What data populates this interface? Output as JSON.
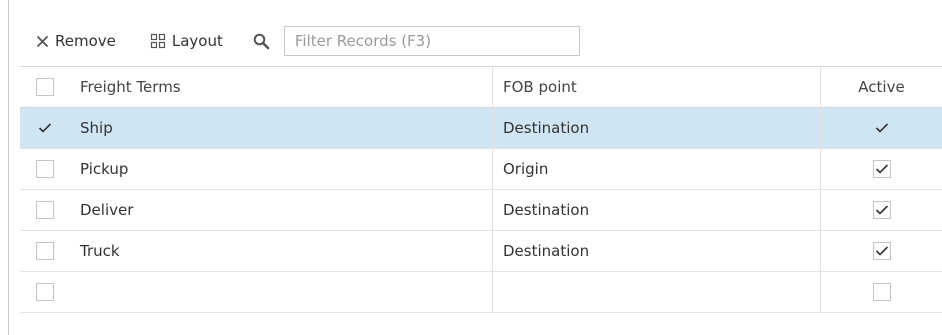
{
  "toolbar": {
    "remove_label": "Remove",
    "layout_label": "Layout",
    "filter_placeholder": "Filter Records (F3)"
  },
  "grid": {
    "columns": [
      "Freight Terms",
      "FOB point",
      "Active"
    ],
    "rows": [
      {
        "freight_terms": "Ship",
        "fob_point": "Destination",
        "active": true,
        "selected": true
      },
      {
        "freight_terms": "Pickup",
        "fob_point": "Origin",
        "active": true,
        "selected": false
      },
      {
        "freight_terms": "Deliver",
        "fob_point": "Destination",
        "active": true,
        "selected": false
      },
      {
        "freight_terms": "Truck",
        "fob_point": "Destination",
        "active": true,
        "selected": false
      },
      {
        "freight_terms": "",
        "fob_point": "",
        "active": false,
        "selected": false
      }
    ]
  },
  "colors": {
    "selected_row": "#cfe5f3",
    "border": "#d8d8d8",
    "text": "#333333"
  }
}
